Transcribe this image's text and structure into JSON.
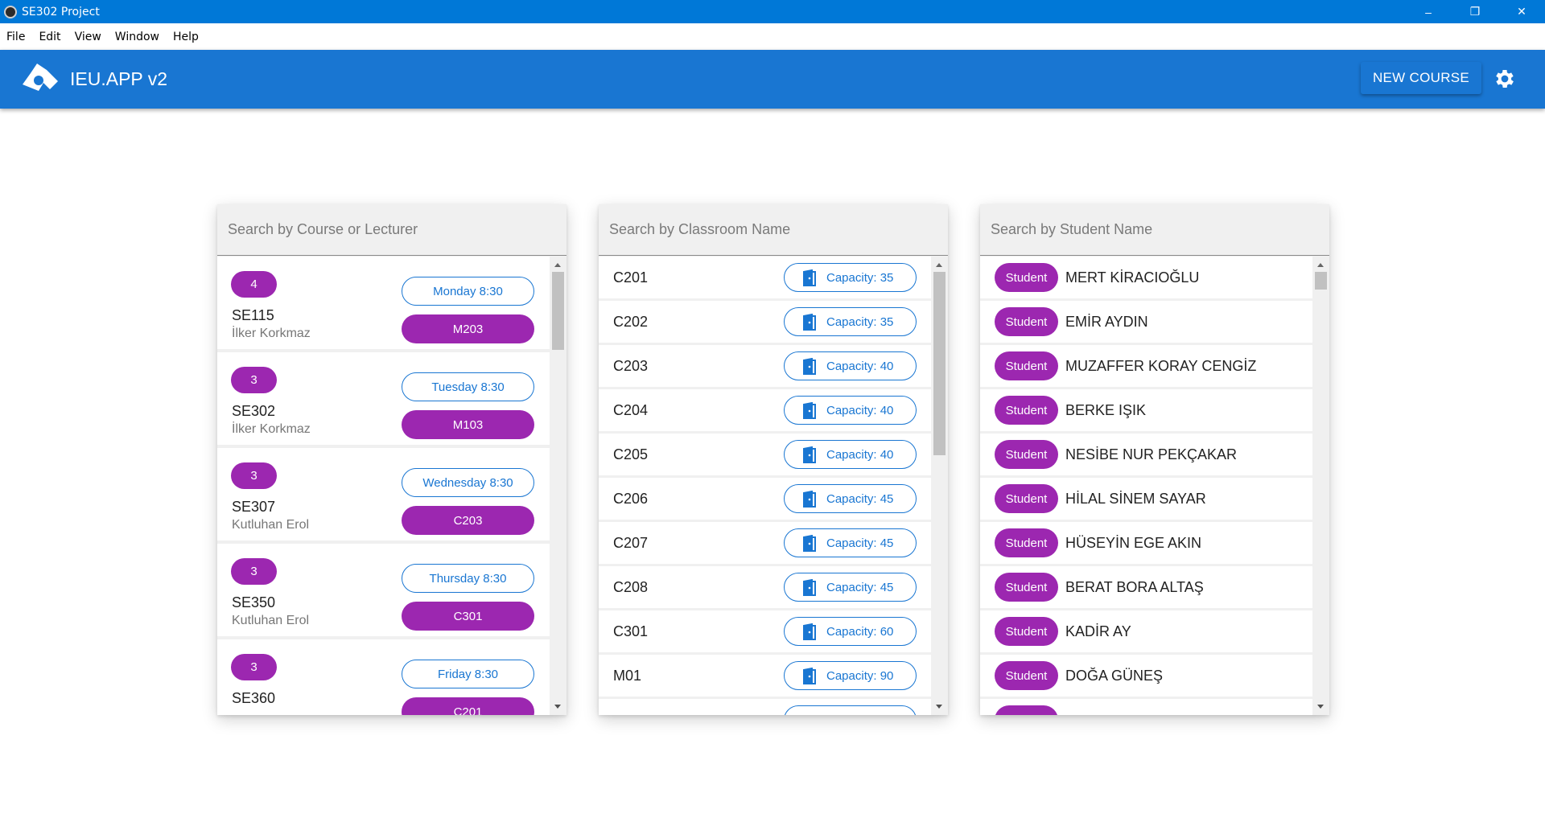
{
  "window": {
    "title": "SE302 Project",
    "controls": {
      "minimize": "–",
      "maximize": "❐",
      "close": "✕"
    }
  },
  "menu": [
    "File",
    "Edit",
    "View",
    "Window",
    "Help"
  ],
  "appbar": {
    "title": "IEU.APP v2",
    "new_course_label": "NEW COURSE",
    "color": "#1976d2"
  },
  "courses_panel": {
    "placeholder": "Search by Course or Lecturer",
    "items": [
      {
        "credit": "4",
        "code": "SE115",
        "lecturer": "İlker Korkmaz",
        "time": "Monday 8:30",
        "room": "M203"
      },
      {
        "credit": "3",
        "code": "SE302",
        "lecturer": "İlker Korkmaz",
        "time": "Tuesday 8:30",
        "room": "M103"
      },
      {
        "credit": "3",
        "code": "SE307",
        "lecturer": "Kutluhan Erol",
        "time": "Wednesday 8:30",
        "room": "C203"
      },
      {
        "credit": "3",
        "code": "SE350",
        "lecturer": "Kutluhan Erol",
        "time": "Thursday 8:30",
        "room": "C301"
      },
      {
        "credit": "3",
        "code": "SE360",
        "lecturer": "",
        "time": "Friday 8:30",
        "room": "C201"
      }
    ]
  },
  "classrooms_panel": {
    "placeholder": "Search by Classroom Name",
    "items": [
      {
        "name": "C201",
        "capacity": "Capacity: 35"
      },
      {
        "name": "C202",
        "capacity": "Capacity: 35"
      },
      {
        "name": "C203",
        "capacity": "Capacity: 40"
      },
      {
        "name": "C204",
        "capacity": "Capacity: 40"
      },
      {
        "name": "C205",
        "capacity": "Capacity: 40"
      },
      {
        "name": "C206",
        "capacity": "Capacity: 45"
      },
      {
        "name": "C207",
        "capacity": "Capacity: 45"
      },
      {
        "name": "C208",
        "capacity": "Capacity: 45"
      },
      {
        "name": "C301",
        "capacity": "Capacity: 60"
      },
      {
        "name": "M01",
        "capacity": "Capacity: 90"
      },
      {
        "name": "",
        "capacity": ""
      }
    ]
  },
  "students_panel": {
    "placeholder": "Search by Student Name",
    "badge_label": "Student",
    "items": [
      "MERT KİRACIOĞLU",
      "EMİR AYDIN",
      "MUZAFFER KORAY CENGİZ",
      "BERKE IŞIK",
      "NESİBE NUR PEKÇAKAR",
      "HİLAL SİNEM SAYAR",
      "HÜSEYİN EGE AKIN",
      "BERAT BORA ALTAŞ",
      "KADİR AY",
      "DOĞA GÜNEŞ",
      ""
    ]
  },
  "colors": {
    "accent": "#9c27b0",
    "primary": "#1976d2"
  }
}
